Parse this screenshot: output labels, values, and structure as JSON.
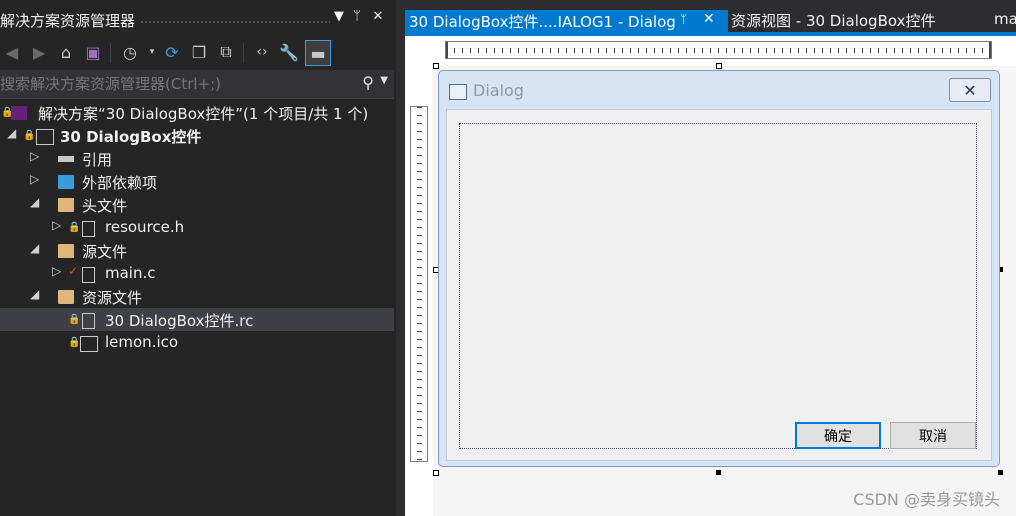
{
  "solution_explorer": {
    "title": "解决方案资源管理器",
    "title_buttons": {
      "dropdown": "▼",
      "pin": "ᛘ",
      "close": "✕"
    },
    "search_placeholder": "搜索解决方案资源管理器(Ctrl+;)",
    "tree": [
      {
        "label": "解决方案“30 DialogBox控件”(1 个项目/共 1 个)",
        "icon": "solution-icon"
      },
      {
        "label": "30 DialogBox控件",
        "icon": "project-icon"
      },
      {
        "label": "引用",
        "icon": "references-icon"
      },
      {
        "label": "外部依赖项",
        "icon": "external-deps-icon"
      },
      {
        "label": "头文件",
        "icon": "folder-icon"
      },
      {
        "label": "resource.h",
        "icon": "header-file-icon"
      },
      {
        "label": "源文件",
        "icon": "folder-icon"
      },
      {
        "label": "main.c",
        "icon": "c-file-icon"
      },
      {
        "label": "资源文件",
        "icon": "folder-icon"
      },
      {
        "label": "30 DialogBox控件.rc",
        "icon": "rc-file-icon",
        "selected": true
      },
      {
        "label": "lemon.ico",
        "icon": "image-file-icon"
      }
    ]
  },
  "tabs": {
    "active": {
      "label": "30 DialogBox控件....IALOG1 - Dialog",
      "pin": "ᛘ",
      "close": "✕"
    },
    "second": {
      "label": "资源视图 - 30 DialogBox控件"
    },
    "third": {
      "label": "ma"
    }
  },
  "dialog": {
    "title": "Dialog",
    "close_glyph": "✕",
    "ok_label": "确定",
    "cancel_label": "取消"
  },
  "watermark": "CSDN @卖身买镜头",
  "colors": {
    "accent": "#007acc",
    "panel_bg": "#252526",
    "selected_row": "#3f3f46"
  }
}
